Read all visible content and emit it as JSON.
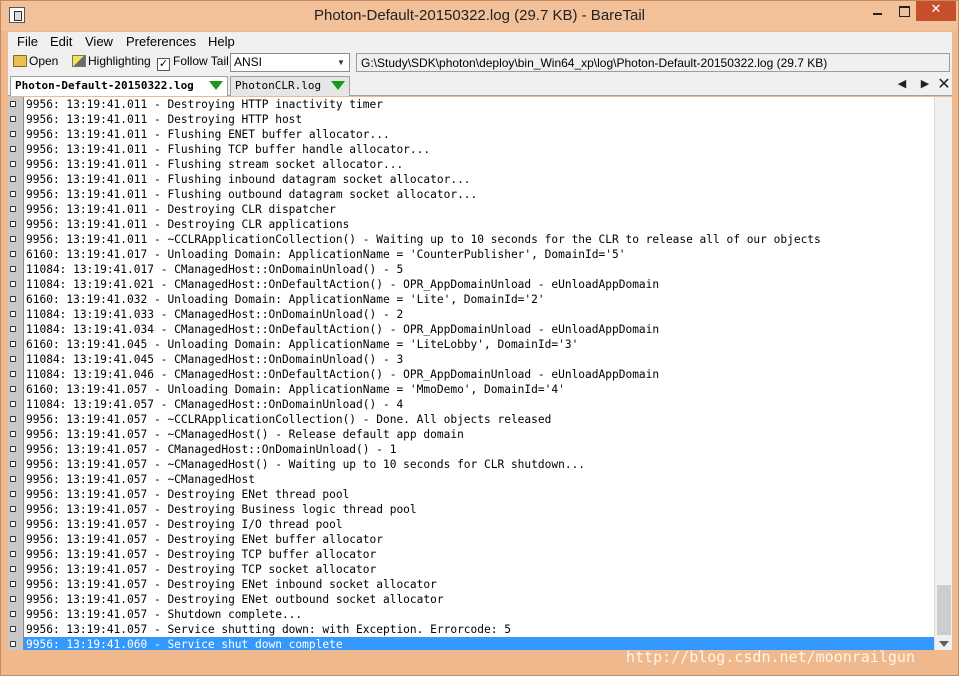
{
  "window": {
    "title": "Photon-Default-20150322.log (29.7 KB) - BareTail"
  },
  "menu": [
    "File",
    "Edit",
    "View",
    "Preferences",
    "Help"
  ],
  "toolbar": {
    "open_label": "Open",
    "highlighting_label": "Highlighting",
    "follow_tail_label": "Follow Tail",
    "follow_tail_checked": true,
    "encoding": "ANSI",
    "file_path": "G:\\Study\\SDK\\photon\\deploy\\bin_Win64_xp\\log\\Photon-Default-20150322.log (29.7 KB)"
  },
  "tabs": [
    {
      "label": "Photon-Default-20150322.log",
      "active": true
    },
    {
      "label": "PhotonCLR.log",
      "active": false
    }
  ],
  "log_lines": [
    "9956: 13:19:41.011 - Destroying HTTP inactivity timer",
    "9956: 13:19:41.011 - Destroying HTTP host",
    "9956: 13:19:41.011 - Flushing ENET buffer allocator...",
    "9956: 13:19:41.011 - Flushing TCP buffer handle allocator...",
    "9956: 13:19:41.011 - Flushing stream socket allocator...",
    "9956: 13:19:41.011 - Flushing inbound datagram socket allocator...",
    "9956: 13:19:41.011 - Flushing outbound datagram socket allocator...",
    "9956: 13:19:41.011 - Destroying CLR dispatcher",
    "9956: 13:19:41.011 - Destroying CLR applications",
    "9956: 13:19:41.011 - ~CCLRApplicationCollection() - Waiting up to 10 seconds for the CLR to release all of our objects",
    "6160: 13:19:41.017 - Unloading Domain: ApplicationName = 'CounterPublisher', DomainId='5'",
    "11084: 13:19:41.017 - CManagedHost::OnDomainUnload() - 5",
    "11084: 13:19:41.021 - CManagedHost::OnDefaultAction() - OPR_AppDomainUnload - eUnloadAppDomain",
    "6160: 13:19:41.032 - Unloading Domain: ApplicationName = 'Lite', DomainId='2'",
    "11084: 13:19:41.033 - CManagedHost::OnDomainUnload() - 2",
    "11084: 13:19:41.034 - CManagedHost::OnDefaultAction() - OPR_AppDomainUnload - eUnloadAppDomain",
    "6160: 13:19:41.045 - Unloading Domain: ApplicationName = 'LiteLobby', DomainId='3'",
    "11084: 13:19:41.045 - CManagedHost::OnDomainUnload() - 3",
    "11084: 13:19:41.046 - CManagedHost::OnDefaultAction() - OPR_AppDomainUnload - eUnloadAppDomain",
    "6160: 13:19:41.057 - Unloading Domain: ApplicationName = 'MmoDemo', DomainId='4'",
    "11084: 13:19:41.057 - CManagedHost::OnDomainUnload() - 4",
    "9956: 13:19:41.057 - ~CCLRApplicationCollection() - Done. All objects released",
    "9956: 13:19:41.057 - ~CManagedHost() - Release default app domain",
    "9956: 13:19:41.057 - CManagedHost::OnDomainUnload() - 1",
    "9956: 13:19:41.057 - ~CManagedHost() - Waiting up to 10 seconds for CLR shutdown...",
    "9956: 13:19:41.057 - ~CManagedHost",
    "9956: 13:19:41.057 - Destroying ENet thread pool",
    "9956: 13:19:41.057 - Destroying Business logic thread pool",
    "9956: 13:19:41.057 - Destroying I/O thread pool",
    "9956: 13:19:41.057 - Destroying ENet buffer allocator",
    "9956: 13:19:41.057 - Destroying TCP buffer allocator",
    "9956: 13:19:41.057 - Destroying TCP socket allocator",
    "9956: 13:19:41.057 - Destroying ENet inbound socket allocator",
    "9956: 13:19:41.057 - Destroying ENet outbound socket allocator",
    "9956: 13:19:41.057 - Shutdown complete...",
    "9956: 13:19:41.057 - Service shutting down: with Exception. Errorcode: 5",
    "9956: 13:19:41.060 - Service shut down complete"
  ],
  "selected_line_index": 36,
  "watermark": "http://blog.csdn.net/moonrailgun"
}
